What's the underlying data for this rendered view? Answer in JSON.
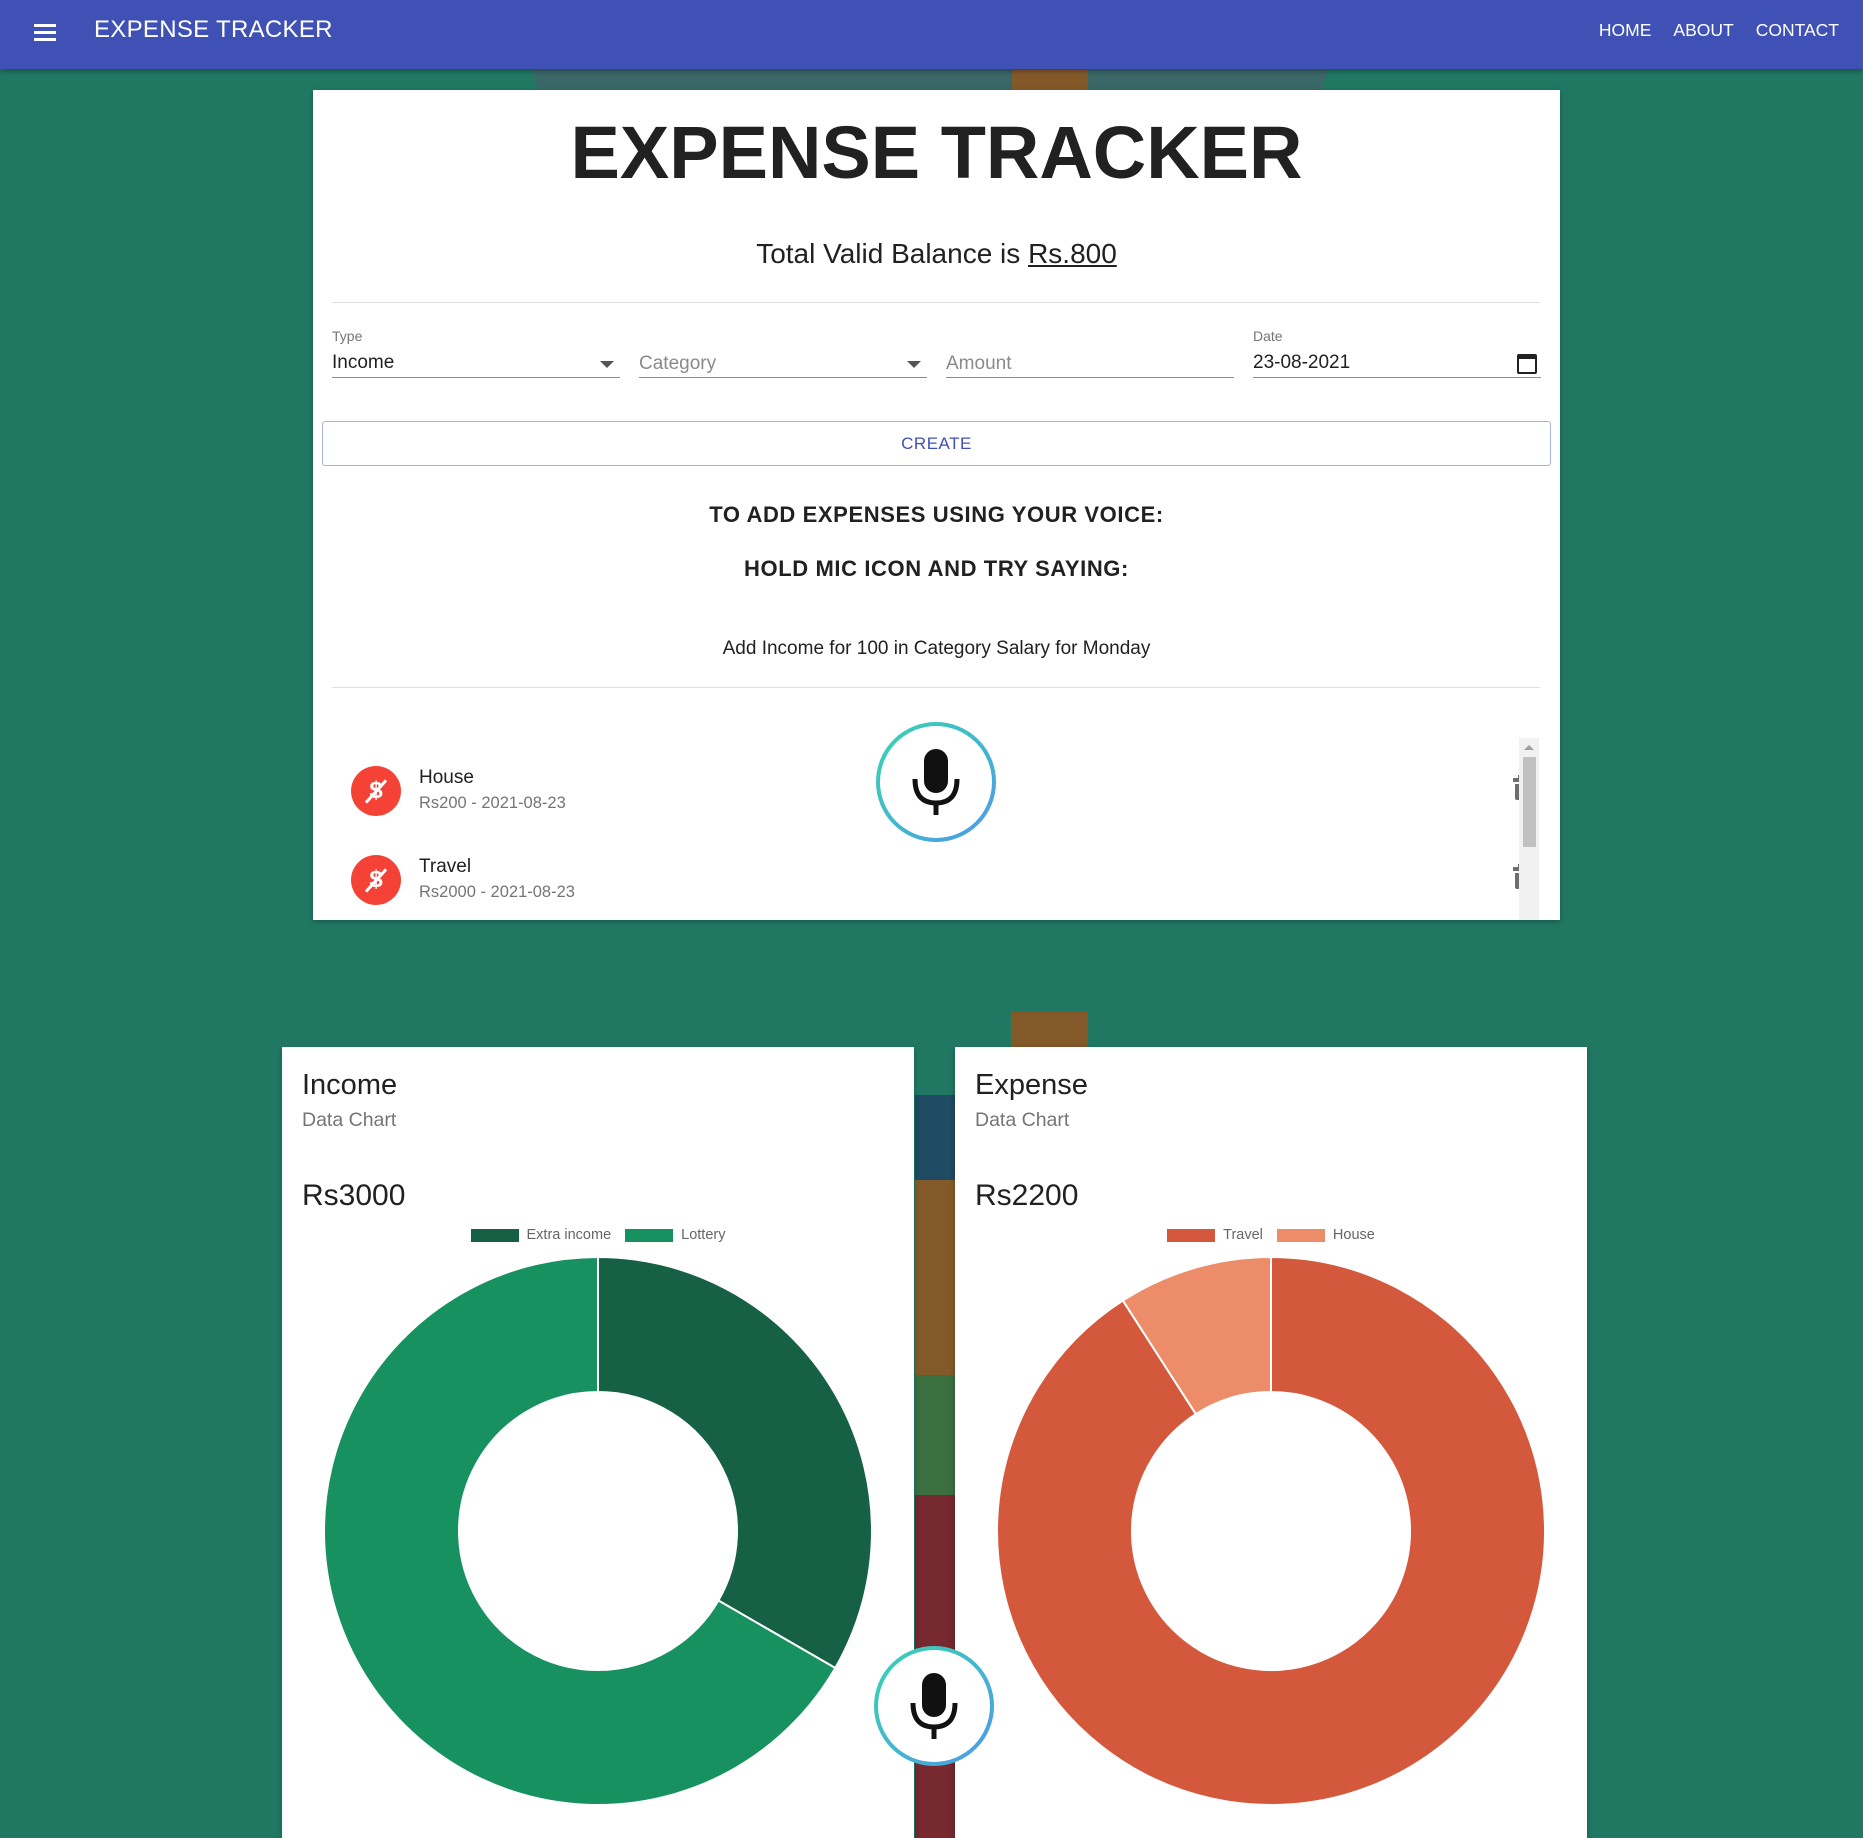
{
  "appbar": {
    "title": "EXPENSE TRACKER",
    "nav": [
      "HOME",
      "ABOUT",
      "CONTACT"
    ]
  },
  "main": {
    "title": "EXPENSE TRACKER",
    "balance_prefix": "Total Valid Balance is ",
    "balance_amount": "Rs.800",
    "form": {
      "type_label": "Type",
      "type_value": "Income",
      "category_placeholder": "Category",
      "amount_placeholder": "Amount",
      "date_label": "Date",
      "date_value": "23-08-2021",
      "create_label": "CREATE"
    },
    "voice": {
      "line1": "TO ADD EXPENSES USING YOUR VOICE:",
      "line2": "HOLD MIC ICON AND TRY SAYING:",
      "example": "Add Income for 100 in Category Salary for Monday"
    },
    "transactions": [
      {
        "name": "House",
        "detail": "Rs200 - 2021-08-23"
      },
      {
        "name": "Travel",
        "detail": "Rs2000 - 2021-08-23"
      }
    ]
  },
  "income_card": {
    "title": "Income",
    "subtitle": "Data Chart",
    "total": "Rs3000"
  },
  "expense_card": {
    "title": "Expense",
    "subtitle": "Data Chart",
    "total": "Rs2200"
  },
  "colors": {
    "appbar": "#3f51b5",
    "background": "#207863",
    "extra_income": "#166146",
    "lottery": "#17915f",
    "travel": "#d4583b",
    "house": "#ec8c68",
    "avatar": "#f44336"
  },
  "chart_data": [
    {
      "type": "pie",
      "title": "Income",
      "categories": [
        "Extra income",
        "Lottery"
      ],
      "values": [
        1000,
        2000
      ],
      "colors": [
        "#166146",
        "#17915f"
      ],
      "legend": "top"
    },
    {
      "type": "pie",
      "title": "Expense",
      "categories": [
        "Travel",
        "House"
      ],
      "values": [
        2000,
        200
      ],
      "colors": [
        "#d4583b",
        "#ec8c68"
      ],
      "legend": "top"
    }
  ]
}
